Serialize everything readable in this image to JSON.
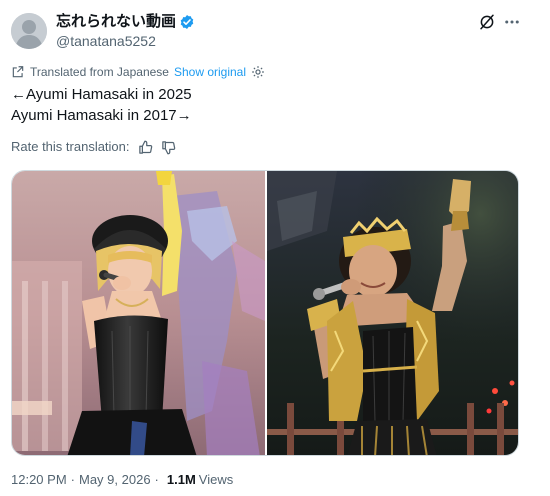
{
  "author": {
    "display_name": "忘れられない動画",
    "handle": "@tanatana5252",
    "verified_icon": "verified-badge-icon"
  },
  "translation": {
    "notice": "Translated from Japanese",
    "show_original": "Show original"
  },
  "tweet": {
    "line1": "←Ayumi Hamasaki in 2025",
    "line2": "Ayumi Hamasaki in 2017→"
  },
  "rate": {
    "label": "Rate this translation:"
  },
  "media": {
    "left_alt": "Ayumi Hamasaki in 2025",
    "right_alt": "Ayumi Hamasaki in 2017"
  },
  "meta": {
    "time": "12:20 PM",
    "date": "May 9, 2026",
    "separator": "·",
    "views_count": "1.1M",
    "views_label": "Views"
  },
  "colors": {
    "accent": "#1d9bf0",
    "secondary_text": "#536471",
    "primary_text": "#0f1419"
  }
}
